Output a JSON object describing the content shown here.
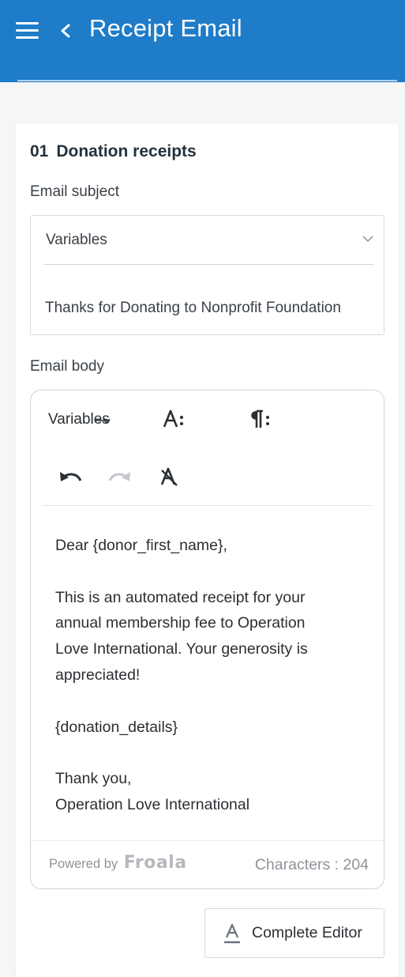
{
  "header": {
    "title": "Receipt Email",
    "background": "#1e7cc8"
  },
  "section": {
    "number": "01",
    "title": "Donation receipts"
  },
  "subject": {
    "label": "Email subject",
    "variables_select": "Variables",
    "value": "Thanks for Donating to Nonprofit Foundation"
  },
  "body": {
    "label": "Email body",
    "toolbar": {
      "variables_label": "Variables",
      "icons": [
        "font-style-icon",
        "paragraph-format-icon",
        "undo-icon",
        "redo-icon",
        "clear-formatting-icon"
      ]
    },
    "lines": [
      "Dear {donor_first_name},",
      "",
      "This is an automated receipt for your",
      "annual membership fee to Operation",
      "Love International. Your generosity is",
      "appreciated!",
      "",
      "{donation_details}",
      "",
      "Thank you,",
      "Operation Love International"
    ],
    "powered_by": "Powered by",
    "powered_brand": "Froala",
    "characters": "Characters : 204"
  },
  "actions": {
    "complete_editor": "Complete Editor"
  }
}
